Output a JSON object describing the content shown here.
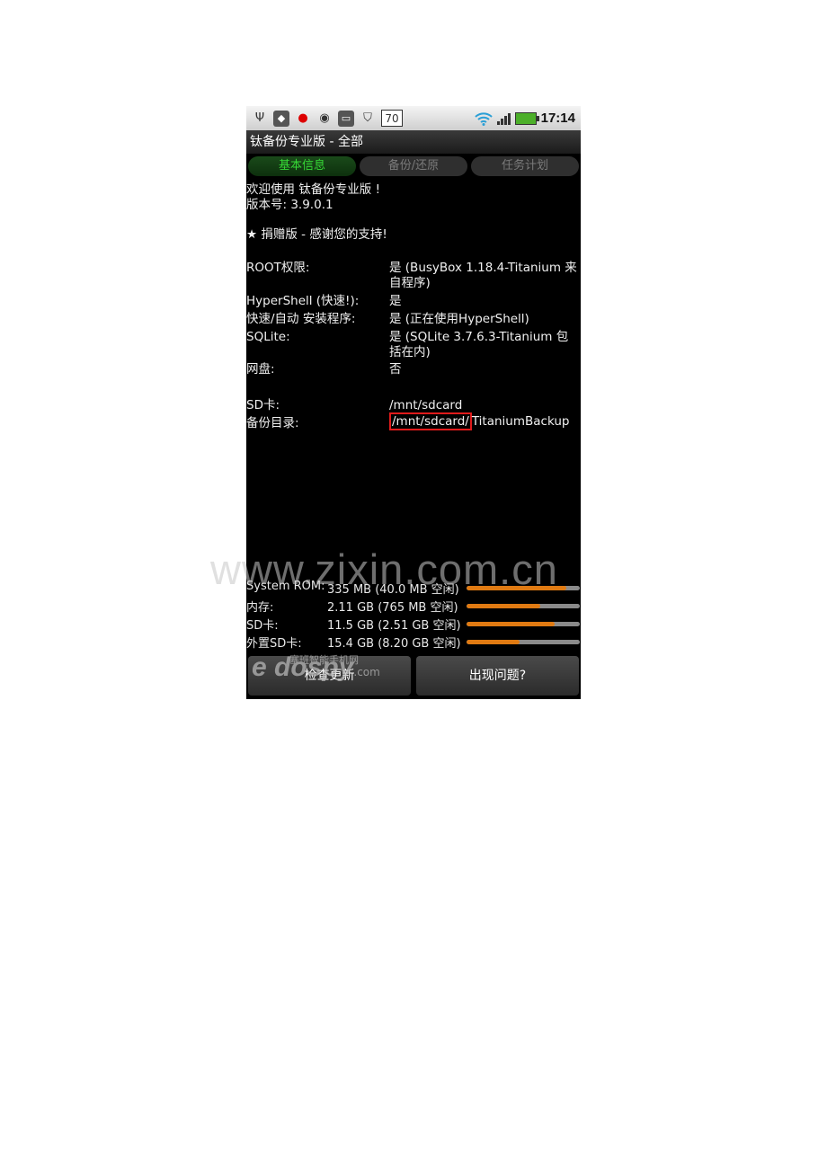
{
  "statusbar": {
    "icons": [
      "usb-icon",
      "android-icon",
      "notification-dot-icon",
      "circle-icon",
      "toggle-icon",
      "shield-icon",
      "calendar-icon"
    ],
    "calendar_day": "70",
    "time": "17:14"
  },
  "app": {
    "title": "钛备份专业版 - 全部"
  },
  "tabs": [
    {
      "label": "基本信息",
      "active": true
    },
    {
      "label": "备份/还原",
      "active": false
    },
    {
      "label": "任务计划",
      "active": false
    }
  ],
  "intro": {
    "welcome": "欢迎使用 钛备份专业版 !",
    "version": "版本号: 3.9.0.1",
    "donate": "★ 捐赠版 - 感谢您的支持!"
  },
  "info": [
    {
      "label": "ROOT权限:",
      "value": "是 (BusyBox 1.18.4-Titanium 来自程序)"
    },
    {
      "label": "HyperShell (快速!):",
      "value": "是"
    },
    {
      "label": "快速/自动 安装程序:",
      "value": "是 (正在使用HyperShell)"
    },
    {
      "label": "SQLite:",
      "value": "是 (SQLite 3.7.6.3-Titanium 包括在内)"
    },
    {
      "label": "网盘:",
      "value": "否"
    },
    {
      "label": "SD卡:",
      "value": "/mnt/sdcard"
    },
    {
      "label": "备份目录:",
      "value_highlight": "/mnt/sdcard/",
      "value_rest": "TitaniumBackup"
    }
  ],
  "storage": [
    {
      "label": "System ROM:",
      "value": "335 MB (40.0 MB 空闲)",
      "used_fraction": 0.88
    },
    {
      "label": "内存:",
      "value": "2.11 GB (765 MB 空闲)",
      "used_fraction": 0.65
    },
    {
      "label": "SD卡:",
      "value": "11.5 GB (2.51 GB 空闲)",
      "used_fraction": 0.78
    },
    {
      "label": "外置SD卡:",
      "value": "15.4 GB (8.20 GB 空闲)",
      "used_fraction": 0.47
    }
  ],
  "buttons": {
    "check_update": "检查更新",
    "problem": "出现问题?"
  },
  "watermarks": {
    "site": "www.zixin.com.cn",
    "logo": "dospy",
    "logo_suffix": ".com",
    "logo_cn": "塞班智能手机网"
  },
  "colors": {
    "tab_active_text": "#36d936",
    "bar_fill": "#e07a12",
    "highlight_border": "#e01b1b"
  }
}
